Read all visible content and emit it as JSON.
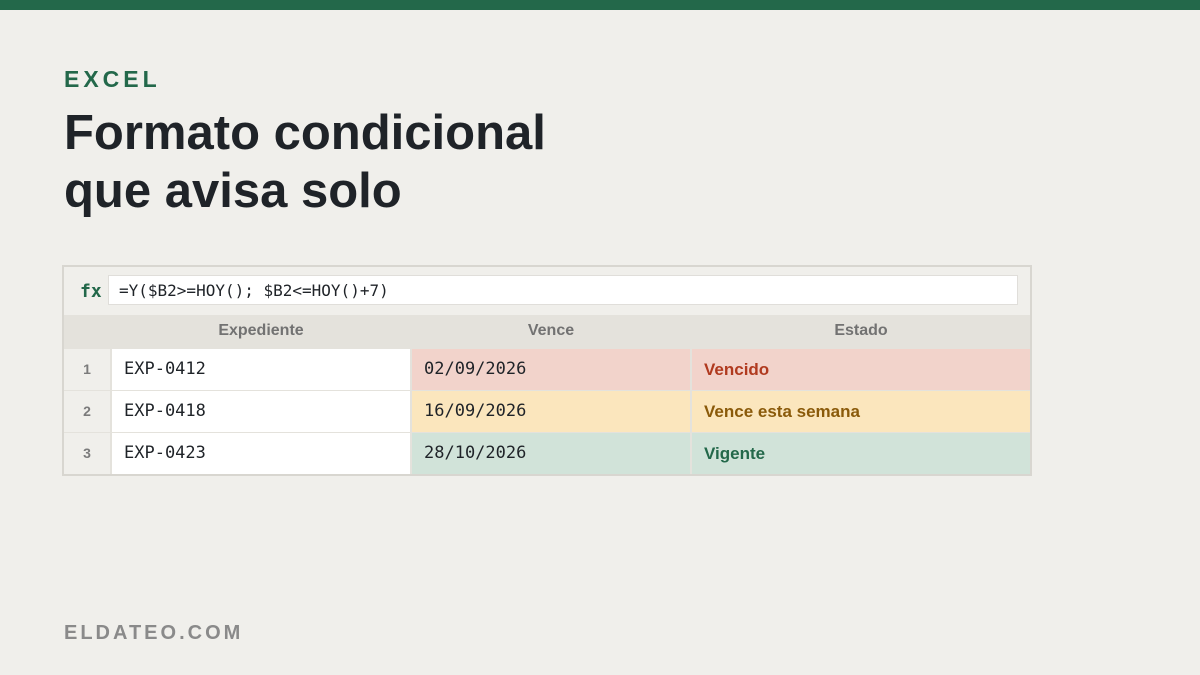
{
  "brand_color": "#23684a",
  "eyebrow": "EXCEL",
  "title": {
    "line1": "Formato condicional",
    "line2": "que avisa solo"
  },
  "formula_bar": {
    "fx_label": "fx",
    "formula": "=Y($B2>=HOY(); $B2<=HOY()+7)"
  },
  "columns": [
    "Expediente",
    "Vence",
    "Estado"
  ],
  "rows": [
    {
      "num": "1",
      "expediente": "EXP-0412",
      "vence": "02/09/2026",
      "estado": "Vencido",
      "fill": "#f2d3cb",
      "text_color": "#b03a1f"
    },
    {
      "num": "2",
      "expediente": "EXP-0418",
      "vence": "16/09/2026",
      "estado": "Vence esta semana",
      "fill": "#fbe6bd",
      "text_color": "#8a5a0a"
    },
    {
      "num": "3",
      "expediente": "EXP-0423",
      "vence": "28/10/2026",
      "estado": "Vigente",
      "fill": "#d1e3d9",
      "text_color": "#23684a"
    }
  ],
  "footer": "ELDATEO.COM"
}
